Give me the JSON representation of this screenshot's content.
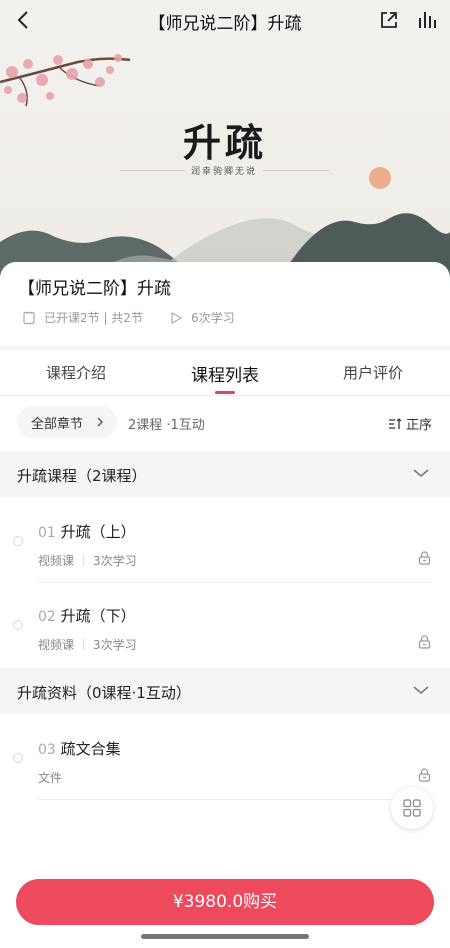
{
  "topbar": {
    "title": "【师兄说二阶】升疏",
    "back_icon": "chevron-left-icon",
    "share_icon": "share-icon",
    "stats_icon": "bar-chart-icon"
  },
  "banner": {
    "title": "升疏",
    "subtitle": "润幸驹卿无说"
  },
  "course": {
    "title": "【师兄说二阶】升疏",
    "lessons_meta": "已开课2节 | 共2节",
    "learners_meta": "6次学习"
  },
  "tabs": [
    {
      "label": "课程介绍"
    },
    {
      "label": "课程列表"
    },
    {
      "label": "用户评价"
    }
  ],
  "filter": {
    "chip_label": "全部章节",
    "summary": "2课程 ·1互动",
    "sort_label": "正序"
  },
  "sections": [
    {
      "title": "升疏课程（2课程）",
      "items": [
        {
          "num": "01",
          "title": "升疏（上）",
          "type": "视频课",
          "count": "3次学习"
        },
        {
          "num": "02",
          "title": "升疏（下）",
          "type": "视频课",
          "count": "3次学习"
        }
      ]
    },
    {
      "title": "升疏资料（0课程·1互动）",
      "items": [
        {
          "num": "03",
          "title": "疏文合集",
          "type": "文件"
        }
      ]
    }
  ],
  "buy_button": "¥3980.0购买",
  "colors": {
    "accent": "#ee4a5d",
    "tab_underline": "#e0455b",
    "section_bg": "#f5f5f5"
  }
}
